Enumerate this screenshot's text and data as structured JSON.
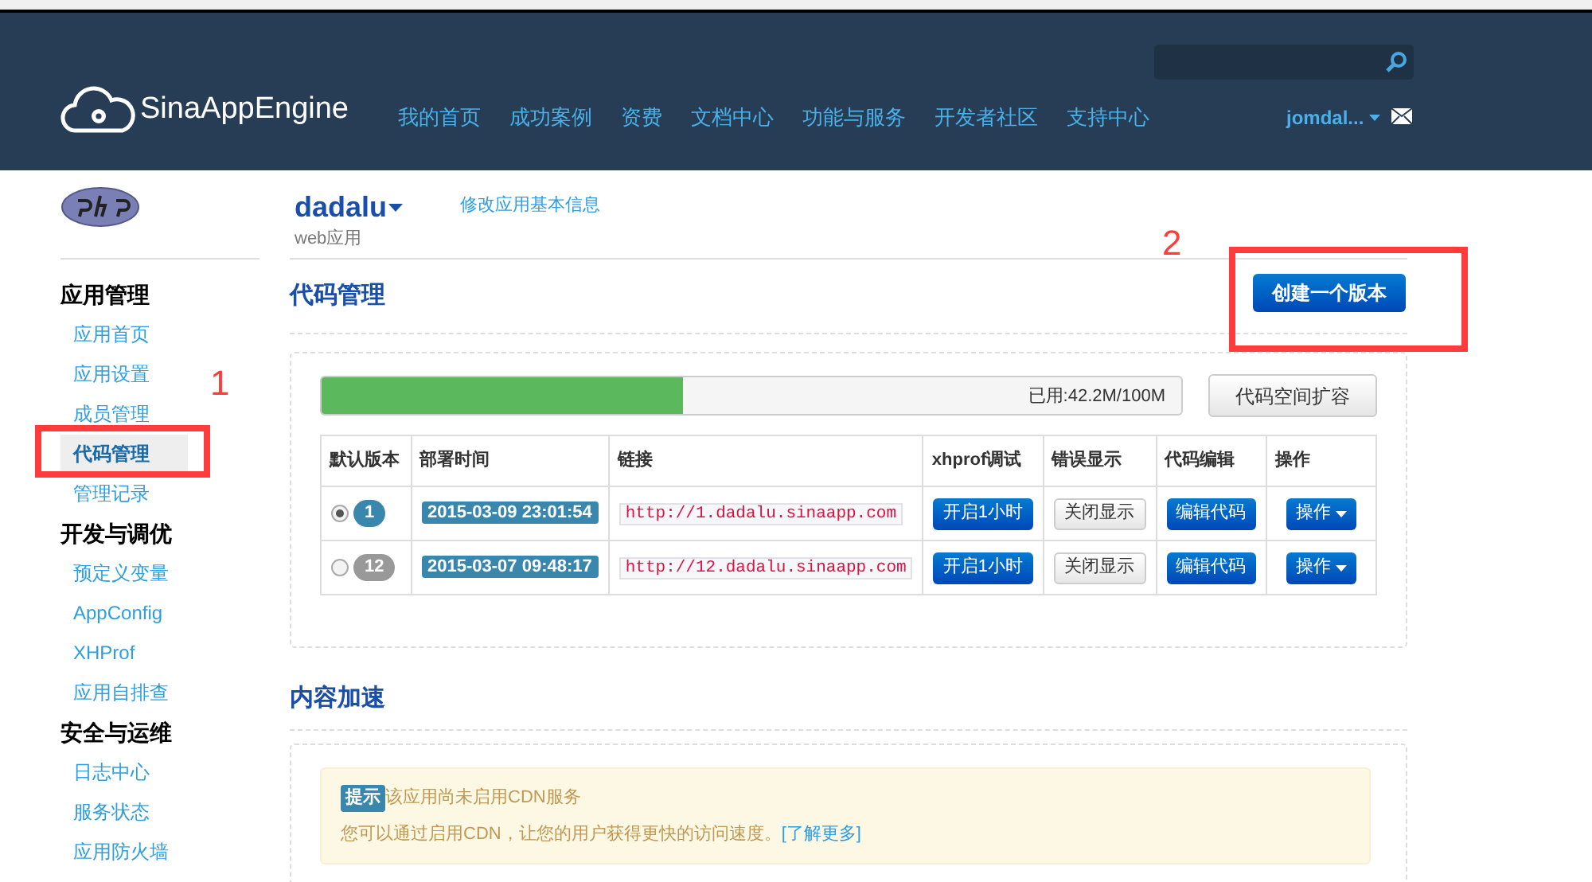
{
  "header": {
    "logo_text": "SinaAppEngine",
    "nav": [
      {
        "label": "我的首页"
      },
      {
        "label": "成功案例"
      },
      {
        "label": "资费"
      },
      {
        "label": "文档中心"
      },
      {
        "label": "功能与服务"
      },
      {
        "label": "开发者社区"
      },
      {
        "label": "支持中心"
      }
    ],
    "user": "jomdal..."
  },
  "app": {
    "name": "dadalu",
    "type": "web应用",
    "edit_link": "修改应用基本信息"
  },
  "sidebar": {
    "groups": [
      {
        "title": "应用管理",
        "items": [
          {
            "label": "应用首页",
            "selected": false
          },
          {
            "label": "应用设置",
            "selected": false
          },
          {
            "label": "成员管理",
            "selected": false
          },
          {
            "label": "代码管理",
            "selected": true
          },
          {
            "label": "管理记录",
            "selected": false
          }
        ]
      },
      {
        "title": "开发与调优",
        "items": [
          {
            "label": "预定义变量",
            "selected": false
          },
          {
            "label": "AppConfig",
            "selected": false
          },
          {
            "label": "XHProf",
            "selected": false
          },
          {
            "label": "应用自排查",
            "selected": false
          }
        ]
      },
      {
        "title": "安全与运维",
        "items": [
          {
            "label": "日志中心",
            "selected": false
          },
          {
            "label": "服务状态",
            "selected": false
          },
          {
            "label": "应用防火墙",
            "selected": false
          }
        ]
      }
    ]
  },
  "code_section": {
    "title": "代码管理",
    "create_button": "创建一个版本",
    "storage": {
      "level": 0.42,
      "reading": "已用:42.2M/100M",
      "expand_button": "代码空间扩容"
    },
    "table": {
      "columns": [
        "默认版本",
        "部署时间",
        "链接",
        "xhprof调试",
        "错误显示",
        "代码编辑",
        "操作"
      ],
      "rows": [
        {
          "selected": true,
          "version": "1",
          "time": "2015-03-09 23:01:54",
          "link": "http://1.dadalu.sinaapp.com",
          "xhprof": "开启1小时",
          "errors": "关闭显示",
          "edit": "编辑代码",
          "action": "操作"
        },
        {
          "selected": false,
          "version": "12",
          "time": "2015-03-07 09:48:17",
          "link": "http://12.dadalu.sinaapp.com",
          "xhprof": "开启1小时",
          "errors": "关闭显示",
          "edit": "编辑代码",
          "action": "操作"
        }
      ]
    }
  },
  "cdn_section": {
    "title": "内容加速",
    "notice": {
      "badge": "提示",
      "line1": "该应用尚未启用CDN服务",
      "line2": "您可以通过启用CDN，让您的用户获得更快的访问速度。",
      "link": "[了解更多]"
    }
  },
  "annotations": [
    {
      "label": "1"
    },
    {
      "label": "2"
    }
  ]
}
